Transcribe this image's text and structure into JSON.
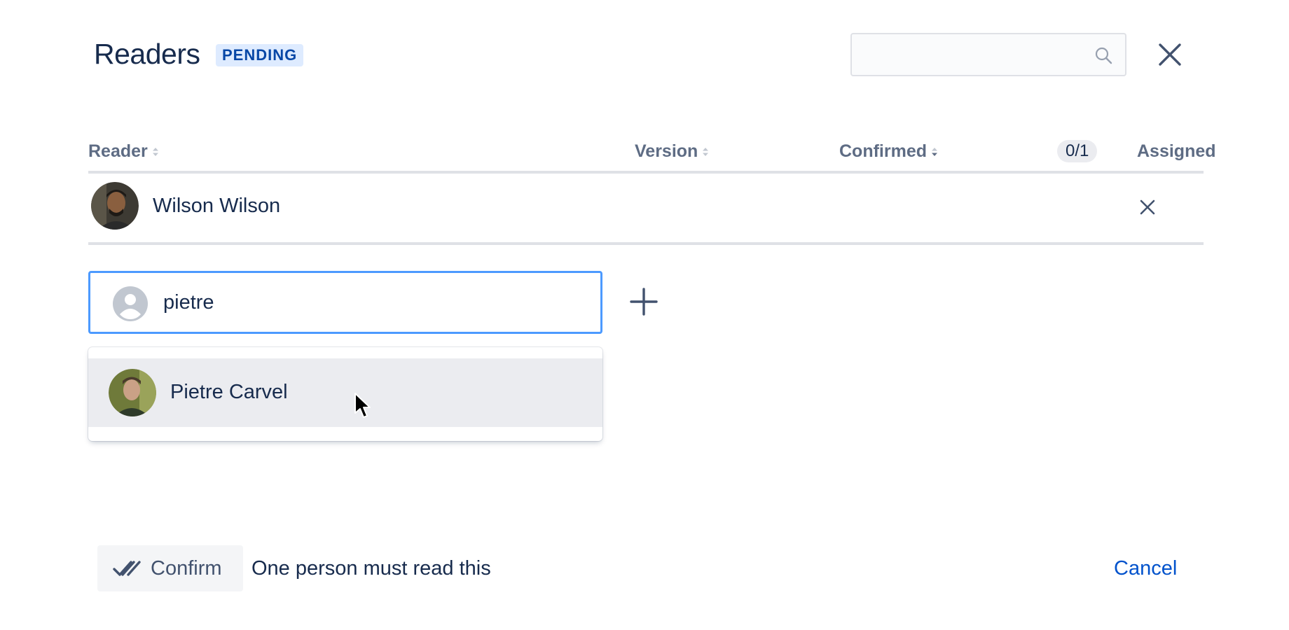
{
  "header": {
    "title": "Readers",
    "status_badge": "PENDING",
    "search_placeholder": "",
    "search_value": ""
  },
  "table": {
    "columns": [
      "Reader",
      "Version",
      "Confirmed",
      "Assigned"
    ],
    "confirmed_count": "0/1",
    "rows": [
      {
        "name": "Wilson Wilson",
        "version": "",
        "confirmed": ""
      }
    ]
  },
  "picker": {
    "value": "pietre",
    "placeholder": "",
    "suggestions": [
      {
        "name": "Pietre Carvel"
      }
    ]
  },
  "footer": {
    "confirm_label": "Confirm",
    "requirement_text": "One person must read this",
    "cancel_label": "Cancel"
  },
  "colors": {
    "primary_text": "#172b4d",
    "muted_text": "#5e6c84",
    "link": "#0052cc",
    "focus_border": "#4c9aff",
    "badge_bg": "#deebff",
    "badge_text": "#0747a6"
  },
  "icons": [
    "search-icon",
    "close-icon",
    "sort-icon",
    "remove-icon",
    "user-placeholder-icon",
    "add-icon",
    "double-check-icon",
    "mouse-cursor-icon"
  ]
}
